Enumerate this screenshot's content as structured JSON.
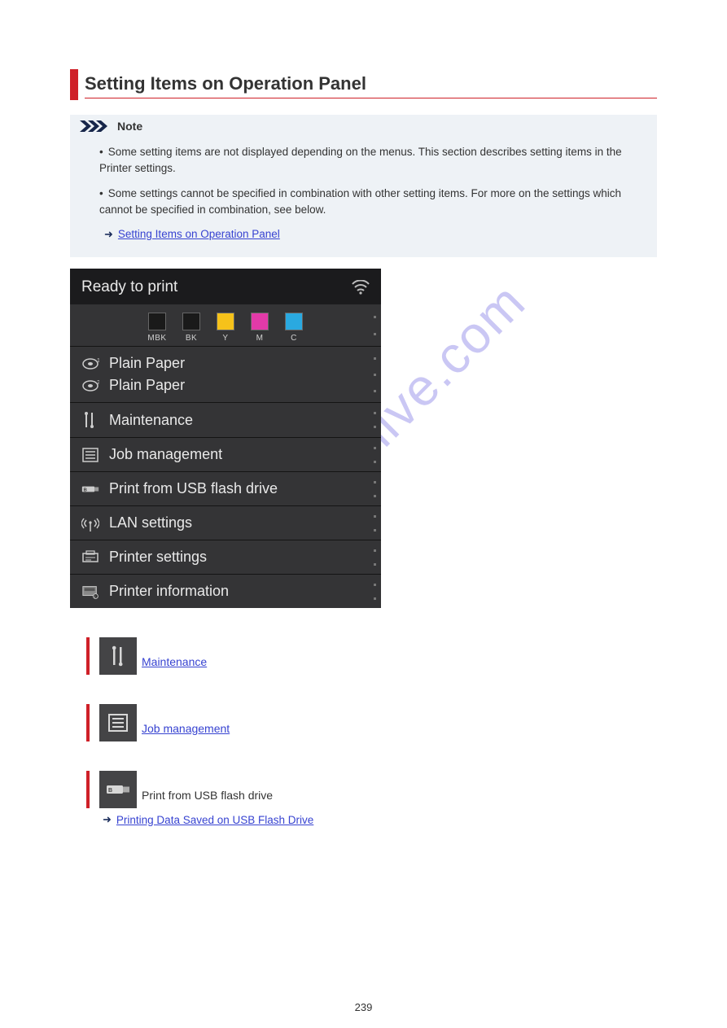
{
  "page": {
    "title": "Setting Items on Operation Panel",
    "number": "239"
  },
  "note": {
    "label": "Note",
    "line1": "Some setting items are not displayed depending on the menus. This section describes setting items in the Printer settings.",
    "line2": "Some settings cannot be specified in combination with other setting items. For more on the settings which cannot be specified in combination, see below.",
    "link": "Setting Items on Operation Panel"
  },
  "screen": {
    "status": "Ready to print",
    "inks": [
      {
        "label": "MBK",
        "color": "#1a1a1a"
      },
      {
        "label": "BK",
        "color": "#1a1a1a"
      },
      {
        "label": "Y",
        "color": "#f6c21a"
      },
      {
        "label": "M",
        "color": "#e23aa8"
      },
      {
        "label": "C",
        "color": "#2aa9e0"
      }
    ],
    "paper1": "Plain Paper",
    "paper2": "Plain Paper",
    "rows": {
      "maintenance": "Maintenance",
      "job": "Job management",
      "usb": "Print from USB flash drive",
      "lan": "LAN settings",
      "printer_settings": "Printer settings",
      "printer_info": "Printer information"
    }
  },
  "items": {
    "maintenance_link": "Maintenance",
    "job_link": "Job management",
    "usb_plain": "Print from USB flash drive",
    "usb_ref": "Printing Data Saved on USB Flash Drive"
  },
  "watermark": "manualshive.com"
}
